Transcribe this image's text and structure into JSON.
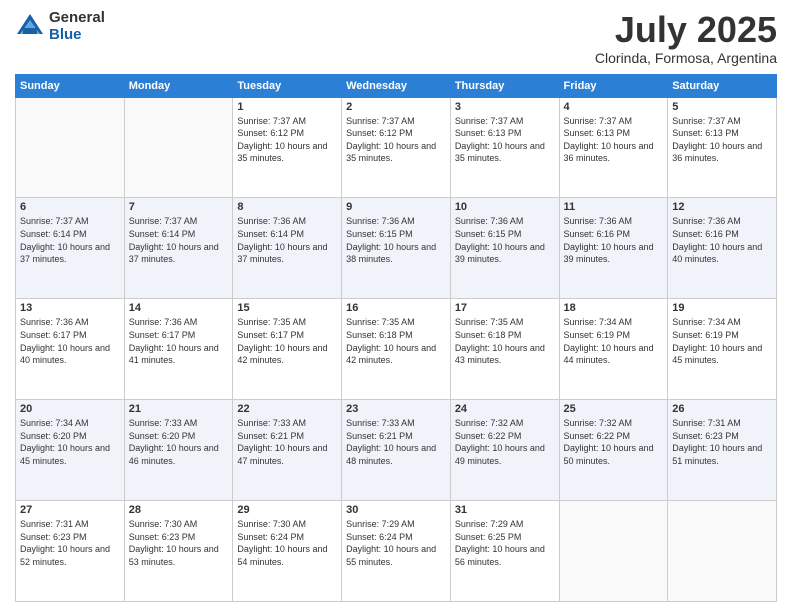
{
  "logo": {
    "general": "General",
    "blue": "Blue"
  },
  "title": "July 2025",
  "location": "Clorinda, Formosa, Argentina",
  "days_of_week": [
    "Sunday",
    "Monday",
    "Tuesday",
    "Wednesday",
    "Thursday",
    "Friday",
    "Saturday"
  ],
  "weeks": [
    [
      {
        "num": "",
        "empty": true
      },
      {
        "num": "",
        "empty": true
      },
      {
        "num": "1",
        "sunrise": "7:37 AM",
        "sunset": "6:12 PM",
        "daylight": "10 hours and 35 minutes."
      },
      {
        "num": "2",
        "sunrise": "7:37 AM",
        "sunset": "6:12 PM",
        "daylight": "10 hours and 35 minutes."
      },
      {
        "num": "3",
        "sunrise": "7:37 AM",
        "sunset": "6:13 PM",
        "daylight": "10 hours and 35 minutes."
      },
      {
        "num": "4",
        "sunrise": "7:37 AM",
        "sunset": "6:13 PM",
        "daylight": "10 hours and 36 minutes."
      },
      {
        "num": "5",
        "sunrise": "7:37 AM",
        "sunset": "6:13 PM",
        "daylight": "10 hours and 36 minutes."
      }
    ],
    [
      {
        "num": "6",
        "sunrise": "7:37 AM",
        "sunset": "6:14 PM",
        "daylight": "10 hours and 37 minutes."
      },
      {
        "num": "7",
        "sunrise": "7:37 AM",
        "sunset": "6:14 PM",
        "daylight": "10 hours and 37 minutes."
      },
      {
        "num": "8",
        "sunrise": "7:36 AM",
        "sunset": "6:14 PM",
        "daylight": "10 hours and 37 minutes."
      },
      {
        "num": "9",
        "sunrise": "7:36 AM",
        "sunset": "6:15 PM",
        "daylight": "10 hours and 38 minutes."
      },
      {
        "num": "10",
        "sunrise": "7:36 AM",
        "sunset": "6:15 PM",
        "daylight": "10 hours and 39 minutes."
      },
      {
        "num": "11",
        "sunrise": "7:36 AM",
        "sunset": "6:16 PM",
        "daylight": "10 hours and 39 minutes."
      },
      {
        "num": "12",
        "sunrise": "7:36 AM",
        "sunset": "6:16 PM",
        "daylight": "10 hours and 40 minutes."
      }
    ],
    [
      {
        "num": "13",
        "sunrise": "7:36 AM",
        "sunset": "6:17 PM",
        "daylight": "10 hours and 40 minutes."
      },
      {
        "num": "14",
        "sunrise": "7:36 AM",
        "sunset": "6:17 PM",
        "daylight": "10 hours and 41 minutes."
      },
      {
        "num": "15",
        "sunrise": "7:35 AM",
        "sunset": "6:17 PM",
        "daylight": "10 hours and 42 minutes."
      },
      {
        "num": "16",
        "sunrise": "7:35 AM",
        "sunset": "6:18 PM",
        "daylight": "10 hours and 42 minutes."
      },
      {
        "num": "17",
        "sunrise": "7:35 AM",
        "sunset": "6:18 PM",
        "daylight": "10 hours and 43 minutes."
      },
      {
        "num": "18",
        "sunrise": "7:34 AM",
        "sunset": "6:19 PM",
        "daylight": "10 hours and 44 minutes."
      },
      {
        "num": "19",
        "sunrise": "7:34 AM",
        "sunset": "6:19 PM",
        "daylight": "10 hours and 45 minutes."
      }
    ],
    [
      {
        "num": "20",
        "sunrise": "7:34 AM",
        "sunset": "6:20 PM",
        "daylight": "10 hours and 45 minutes."
      },
      {
        "num": "21",
        "sunrise": "7:33 AM",
        "sunset": "6:20 PM",
        "daylight": "10 hours and 46 minutes."
      },
      {
        "num": "22",
        "sunrise": "7:33 AM",
        "sunset": "6:21 PM",
        "daylight": "10 hours and 47 minutes."
      },
      {
        "num": "23",
        "sunrise": "7:33 AM",
        "sunset": "6:21 PM",
        "daylight": "10 hours and 48 minutes."
      },
      {
        "num": "24",
        "sunrise": "7:32 AM",
        "sunset": "6:22 PM",
        "daylight": "10 hours and 49 minutes."
      },
      {
        "num": "25",
        "sunrise": "7:32 AM",
        "sunset": "6:22 PM",
        "daylight": "10 hours and 50 minutes."
      },
      {
        "num": "26",
        "sunrise": "7:31 AM",
        "sunset": "6:23 PM",
        "daylight": "10 hours and 51 minutes."
      }
    ],
    [
      {
        "num": "27",
        "sunrise": "7:31 AM",
        "sunset": "6:23 PM",
        "daylight": "10 hours and 52 minutes."
      },
      {
        "num": "28",
        "sunrise": "7:30 AM",
        "sunset": "6:23 PM",
        "daylight": "10 hours and 53 minutes."
      },
      {
        "num": "29",
        "sunrise": "7:30 AM",
        "sunset": "6:24 PM",
        "daylight": "10 hours and 54 minutes."
      },
      {
        "num": "30",
        "sunrise": "7:29 AM",
        "sunset": "6:24 PM",
        "daylight": "10 hours and 55 minutes."
      },
      {
        "num": "31",
        "sunrise": "7:29 AM",
        "sunset": "6:25 PM",
        "daylight": "10 hours and 56 minutes."
      },
      {
        "num": "",
        "empty": true
      },
      {
        "num": "",
        "empty": true
      }
    ]
  ],
  "labels": {
    "sunrise": "Sunrise:",
    "sunset": "Sunset:",
    "daylight": "Daylight:"
  }
}
